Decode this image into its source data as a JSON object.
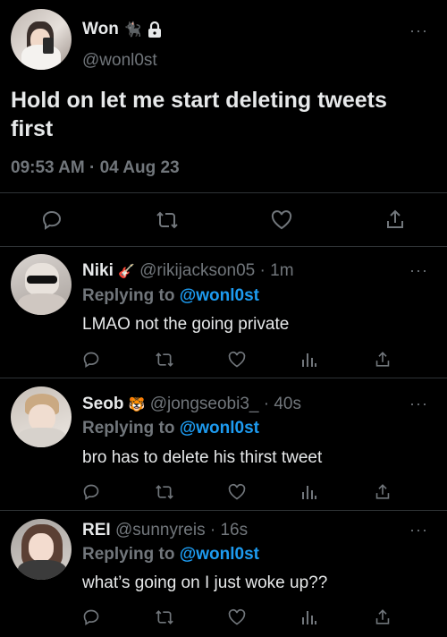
{
  "main_tweet": {
    "display_name": "Won",
    "name_emoji": "🐈‍⬛",
    "handle": "@wonl0st",
    "text": "Hold on let me start deleting tweets first",
    "timestamp": "09:53 AM · 04 Aug 23"
  },
  "replies": [
    {
      "display_name": "Niki",
      "name_emoji": "🎸",
      "handle": "@rikijackson05",
      "time": "· 1m",
      "replying_prefix": "Replying to",
      "replying_to": "@wonl0st",
      "text": "LMAO not the going private"
    },
    {
      "display_name": "Seob",
      "name_emoji": "🐯",
      "handle": "@jongseobi3_",
      "time": "· 40s",
      "replying_prefix": "Replying to",
      "replying_to": "@wonl0st",
      "text": "bro has to delete his thirst tweet"
    },
    {
      "display_name": "REI",
      "name_emoji": "",
      "handle": "@sunnyreis",
      "time": "· 16s",
      "replying_prefix": "Replying to",
      "replying_to": "@wonl0st",
      "text": "what’s going on I just woke up??"
    }
  ],
  "more_glyph": "···",
  "colors": {
    "background": "#000000",
    "text": "#e7e9ea",
    "secondary": "#71767b",
    "accent": "#1d9bf0",
    "divider": "#2f3336"
  },
  "icons": [
    "more-icon",
    "lock-icon",
    "reply-icon",
    "retweet-icon",
    "like-icon",
    "views-icon",
    "share-icon"
  ]
}
